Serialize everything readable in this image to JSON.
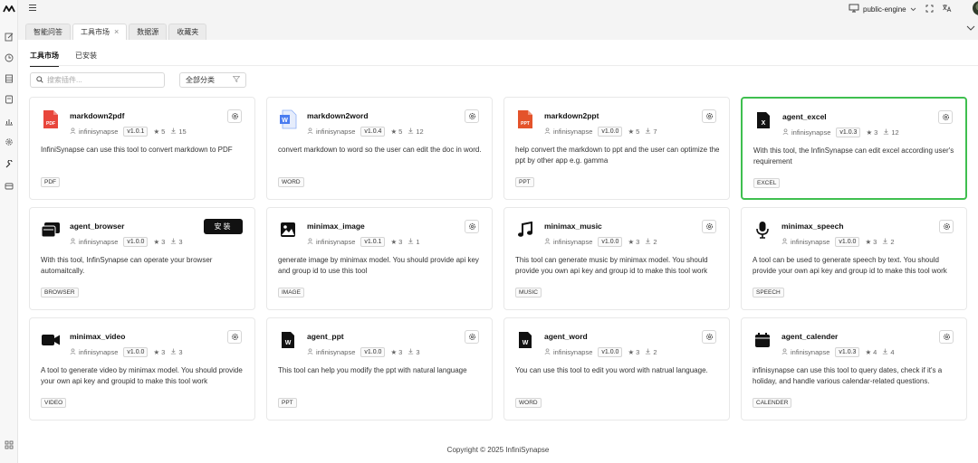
{
  "engine": {
    "label": "public-engine"
  },
  "tabs": [
    {
      "label": "智能问答"
    },
    {
      "label": "工具市场",
      "close": "×"
    },
    {
      "label": "数据源"
    },
    {
      "label": "收藏夹"
    }
  ],
  "subtabs": [
    {
      "label": "工具市场"
    },
    {
      "label": "已安装"
    }
  ],
  "search": {
    "placeholder": "搜索插件..."
  },
  "category": {
    "selected": "全部分类"
  },
  "install_label": "安装",
  "colors": {
    "highlight": "#3fbf4f",
    "pdf": "#e8463c",
    "word": "#4a7cf0",
    "ppt": "#e4532b"
  },
  "cards": [
    {
      "name": "markdown2pdf",
      "icon": "pdf-file-icon",
      "author": "infinisynapse",
      "version": "v1.0.1",
      "stars": "5",
      "downloads": "15",
      "desc": "InfiniSynapse can use this tool to convert markdown to PDF",
      "tag": "PDF"
    },
    {
      "name": "markdown2word",
      "icon": "word-file-icon",
      "author": "infinisynapse",
      "version": "v1.0.4",
      "stars": "5",
      "downloads": "12",
      "desc": "convert markdown to word so the user can edit the doc in word.",
      "tag": "WORD"
    },
    {
      "name": "markdown2ppt",
      "icon": "ppt-file-icon",
      "author": "infinisynapse",
      "version": "v1.0.0",
      "stars": "5",
      "downloads": "7",
      "desc": "help convert the markdown to ppt and the user can optimize the ppt by other app e.g. gamma",
      "tag": "PPT"
    },
    {
      "name": "agent_excel",
      "icon": "excel-file-icon",
      "author": "infinisynapse",
      "version": "v1.0.3",
      "stars": "3",
      "downloads": "12",
      "desc": "With this tool, the InfinSynapse can edit excel according user's requirement",
      "tag": "EXCEL"
    },
    {
      "name": "agent_browser",
      "icon": "browser-icon",
      "author": "infinisynapse",
      "version": "v1.0.0",
      "stars": "3",
      "downloads": "3",
      "desc": "With this tool, InfinSynapse can operate your browser automaitcally.",
      "tag": "BROWSER"
    },
    {
      "name": "minimax_image",
      "icon": "image-icon",
      "author": "infinisynapse",
      "version": "v1.0.1",
      "stars": "3",
      "downloads": "1",
      "desc": "generate image by minimax model. You should provide api key and group id to use this tool",
      "tag": "IMAGE"
    },
    {
      "name": "minimax_music",
      "icon": "music-note-icon",
      "author": "infinisynapse",
      "version": "v1.0.0",
      "stars": "3",
      "downloads": "2",
      "desc": "This tool can generate music by minimax model. You should provide you own api key and group id to make this tool work",
      "tag": "MUSIC"
    },
    {
      "name": "minimax_speech",
      "icon": "microphone-icon",
      "author": "infinisynapse",
      "version": "v1.0.0",
      "stars": "3",
      "downloads": "2",
      "desc": "A tool can be used to generate speech by text. You should provide your own api key and group id to make this tool work",
      "tag": "SPEECH"
    },
    {
      "name": "minimax_video",
      "icon": "video-camera-icon",
      "author": "infinisynapse",
      "version": "v1.0.0",
      "stars": "3",
      "downloads": "3",
      "desc": "A tool to generate video by minimax model. You should provide your own api key and groupid to make this tool work",
      "tag": "VIDEO"
    },
    {
      "name": "agent_ppt",
      "icon": "ppt-doc-icon",
      "author": "infinisynapse",
      "version": "v1.0.0",
      "stars": "3",
      "downloads": "3",
      "desc": "This tool can help you modify the ppt with natural language",
      "tag": "PPT"
    },
    {
      "name": "agent_word",
      "icon": "word-doc-icon",
      "author": "infinisynapse",
      "version": "v1.0.0",
      "stars": "3",
      "downloads": "2",
      "desc": "You can use this tool to edit you word with natrual language.",
      "tag": "WORD"
    },
    {
      "name": "agent_calender",
      "icon": "calendar-icon",
      "author": "infinisynapse",
      "version": "v1.0.3",
      "stars": "4",
      "downloads": "4",
      "desc": "infinisynapse can use this tool to query dates, check if it's a holiday, and handle various calendar-related questions.",
      "tag": "CALENDER"
    }
  ],
  "footer": {
    "text": "Copyright © 2025 InfiniSynapse"
  }
}
